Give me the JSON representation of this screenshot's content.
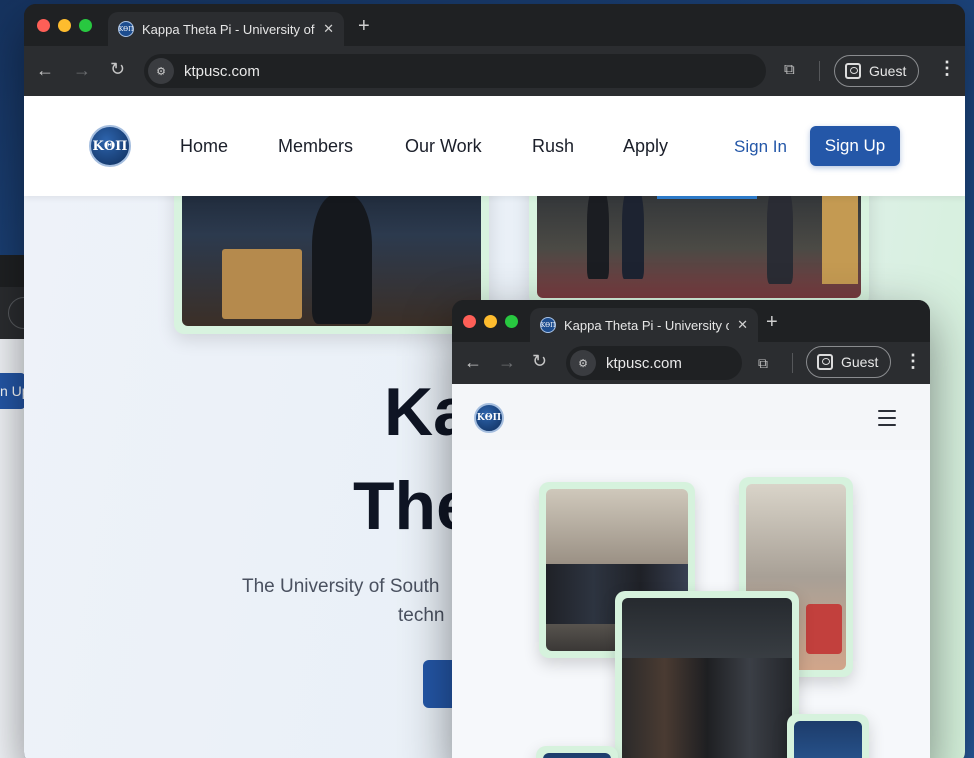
{
  "back_window": {
    "signup_partial": "n Up"
  },
  "main_window": {
    "tab": {
      "title": "Kappa Theta Pi - University of",
      "favicon": "ktp-favicon-icon"
    },
    "omnibox": {
      "url": "ktpusc.com"
    },
    "profile": {
      "label": "Guest"
    },
    "nav": {
      "logo_text": "ΚΘΠ",
      "links": [
        "Home",
        "Members",
        "Our Work",
        "Rush",
        "Apply"
      ],
      "signin": "Sign In",
      "signup": "Sign Up"
    },
    "hero": {
      "title_line1": "Ka",
      "title_line2": "The",
      "subtitle_line1": "The University of South",
      "subtitle_line2": "techn"
    },
    "colors": {
      "accent": "#2457a8",
      "chrome_dark": "#1f2123",
      "photo_frame": "#d8f3df"
    }
  },
  "front_window": {
    "tab": {
      "title": "Kappa Theta Pi - University of",
      "favicon": "ktp-favicon-icon"
    },
    "omnibox": {
      "url": "ktpusc.com"
    },
    "profile": {
      "label": "Guest"
    },
    "logo_text": "ΚΘΠ",
    "menu_icon": "hamburger-icon"
  }
}
